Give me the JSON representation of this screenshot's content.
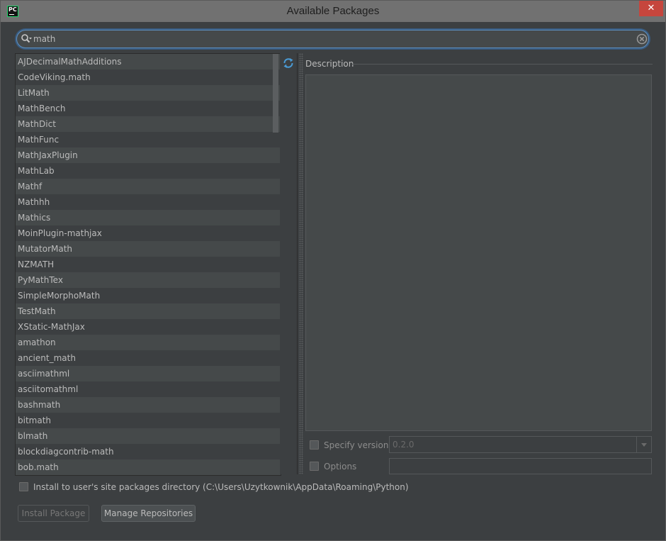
{
  "window": {
    "title": "Available Packages",
    "close_glyph": "✕",
    "app_icon": "pycharm-icon"
  },
  "search": {
    "value": "math",
    "icon": "search-icon",
    "clear_icon": "clear-icon"
  },
  "packages": [
    "AJDecimalMathAdditions",
    "CodeViking.math",
    "LitMath",
    "MathBench",
    "MathDict",
    "MathFunc",
    "MathJaxPlugin",
    "MathLab",
    "Mathf",
    "Mathhh",
    "Mathics",
    "MoinPlugin-mathjax",
    "MutatorMath",
    "NZMATH",
    "PyMathTex",
    "SimpleMorphoMath",
    "TestMath",
    "XStatic-MathJax",
    "amathon",
    "ancient_math",
    "asciimathml",
    "asciitomathml",
    "bashmath",
    "bitmath",
    "blmath",
    "blockdiagcontrib-math",
    "bob.math"
  ],
  "description": {
    "label": "Description"
  },
  "specify_version": {
    "label": "Specify version",
    "value": "0.2.0",
    "checked": false
  },
  "options": {
    "label": "Options",
    "checked": false,
    "value": ""
  },
  "install_user": {
    "label": "Install to user's site packages directory (C:\\Users\\Uzytkownik\\AppData\\Roaming\\Python)",
    "checked": false
  },
  "buttons": {
    "install": "Install Package",
    "manage": "Manage Repositories"
  },
  "colors": {
    "background": "#3c3f41",
    "titlebar": "#717171",
    "close": "#c6463d",
    "accent": "#5d8fbf",
    "refresh": "#4a9bd6"
  }
}
